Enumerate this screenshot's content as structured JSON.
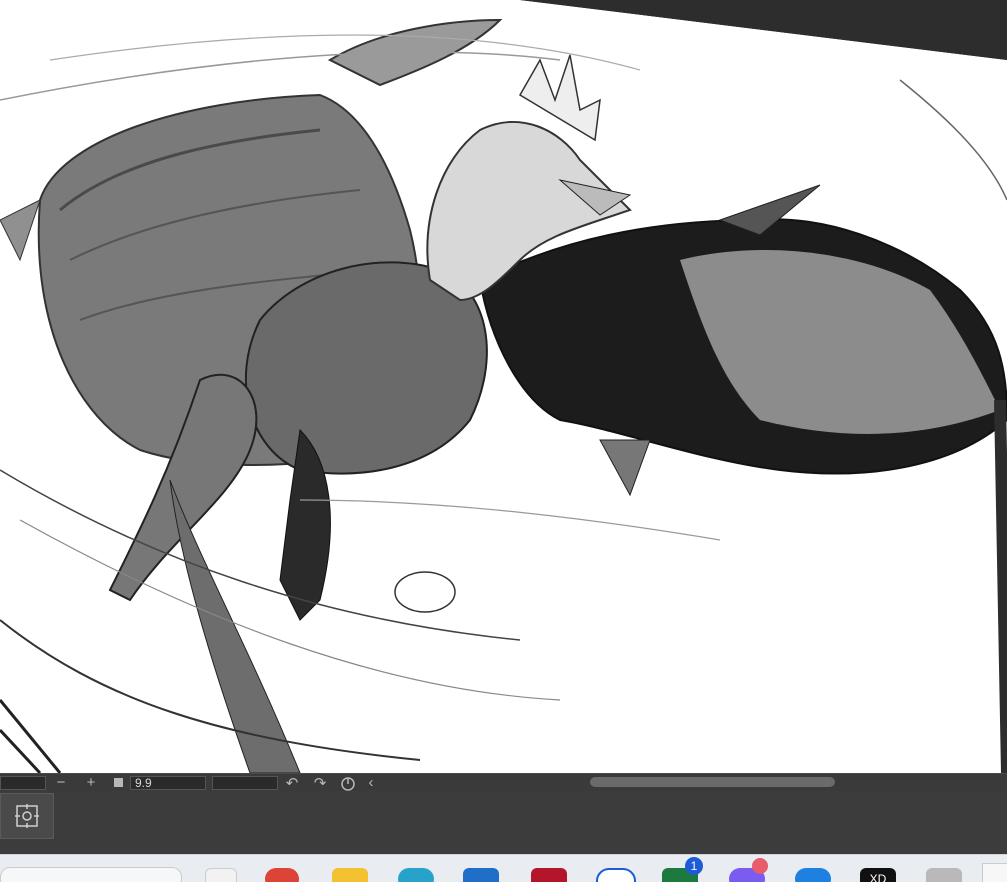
{
  "canvas": {
    "artwork": "dragon-sketch"
  },
  "status_bar": {
    "zoom_out": "−",
    "zoom_in": "+",
    "fit_icon": "square-icon",
    "zoom_value": "9.9",
    "rotate_left_icon": "undo-rotate-icon",
    "rotate_right_icon": "redo-rotate-icon",
    "reset_rotation_icon": "reset-rotation-icon",
    "collapse": "‹"
  },
  "taskbar": {
    "apps": [
      {
        "name": "file-icon"
      },
      {
        "name": "chrome-icon"
      },
      {
        "name": "folder-icon"
      },
      {
        "name": "edge-icon"
      },
      {
        "name": "store-icon"
      },
      {
        "name": "clip-studio-icon"
      },
      {
        "name": "clock-icon"
      },
      {
        "name": "excel-icon",
        "badge": "1"
      },
      {
        "name": "messenger-icon"
      },
      {
        "name": "arrow-app-icon"
      },
      {
        "name": "xd-icon",
        "label": "XD"
      },
      {
        "name": "misc-app-icon"
      }
    ]
  },
  "colors": {
    "panel": "#3c3c3c",
    "statusbar": "#3a3a3a",
    "taskbar": "#e9ecf1"
  }
}
